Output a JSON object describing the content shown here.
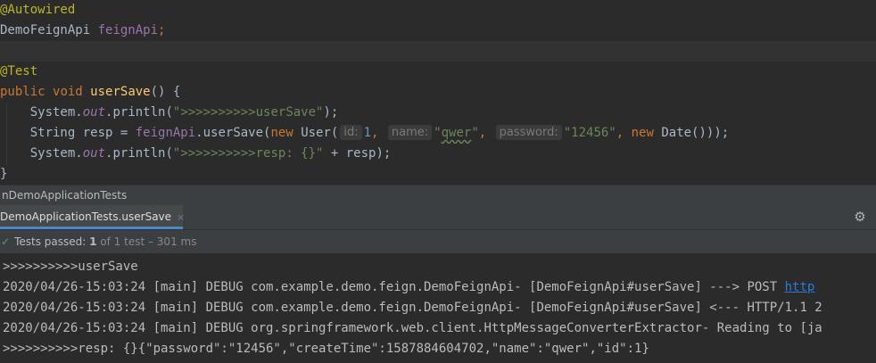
{
  "editor": {
    "line1": {
      "annotation": "@Autowired"
    },
    "line2": {
      "type": "DemoFeignApi",
      "field": "feignApi",
      "semi": ";"
    },
    "line4": {
      "annotation": "@Test"
    },
    "line5": {
      "kw_public": "public",
      "kw_void": "void",
      "method": "userSave",
      "rest": "() {"
    },
    "line6": {
      "cls": "System.",
      "out": "out",
      "call": ".println(",
      "str": "\">>>>>>>>>>userSave\"",
      "end": ");"
    },
    "line7": {
      "pre": "String resp = ",
      "field": "feignApi",
      "call": ".userSave(",
      "kw_new": "new",
      "user_open": " User(",
      "hint_id": "id:",
      "num": "1",
      "comma1": ",",
      "hint_name": "name:",
      "str_name_q1": "\"",
      "str_name": "qwer",
      "str_name_q2": "\"",
      "comma2": ",",
      "hint_password": "password:",
      "str_password": "\"12456\"",
      "comma3": ", ",
      "kw_new2": "new",
      "tail": " Date()));"
    },
    "line8": {
      "cls": "System.",
      "out": "out",
      "call": ".println(",
      "str": "\">>>>>>>>>>resp: {}\"",
      "end": " + resp);"
    },
    "line9": {
      "brace": "}"
    }
  },
  "run": {
    "title": "nDemoApplicationTests",
    "tab_label": "DemoApplicationTests.userSave",
    "tab_close": "×",
    "settings_icon": "gear-icon",
    "status_prefix": "Tests passed:",
    "status_count": "1",
    "status_detail": "of 1 test – 301 ms"
  },
  "console": {
    "lines": [
      ">>>>>>>>>>userSave",
      "2020/04/26-15:03:24 [main] DEBUG com.example.demo.feign.DemoFeignApi- [DemoFeignApi#userSave] ---> POST ",
      "2020/04/26-15:03:24 [main] DEBUG com.example.demo.feign.DemoFeignApi- [DemoFeignApi#userSave] <--- HTTP/1.1 2",
      "2020/04/26-15:03:24 [main] DEBUG org.springframework.web.client.HttpMessageConverterExtractor- Reading to [ja",
      ">>>>>>>>>>resp: {}{\"password\":\"12456\",\"createTime\":1587884604702,\"name\":\"qwer\",\"id\":1}"
    ],
    "link_text": "http"
  },
  "colors": {
    "background": "#2b2b2b",
    "keyword": "#cc7832",
    "string": "#6a8759",
    "annotation": "#bbb529",
    "method": "#ffc66d",
    "field": "#9876aa",
    "tab_accent": "#4a88c7",
    "link": "#287bde"
  }
}
